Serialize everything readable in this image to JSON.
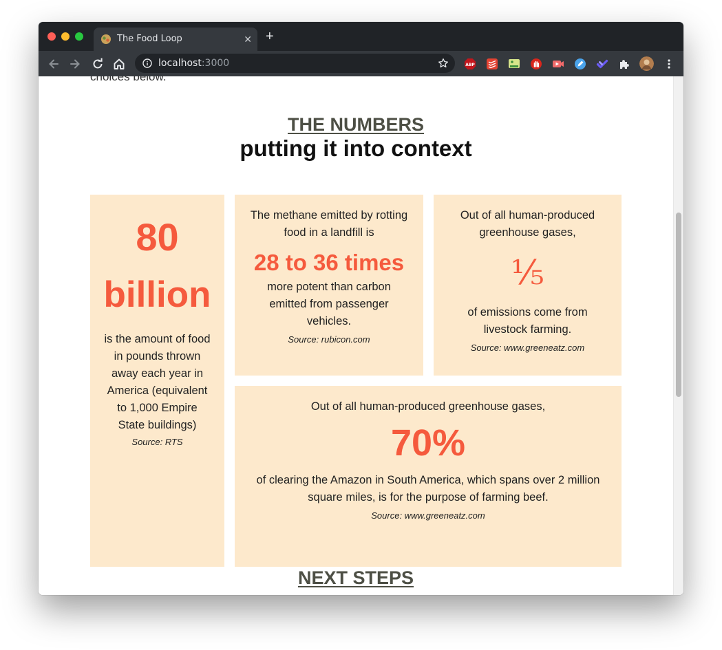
{
  "browser": {
    "tab_title": "The Food Loop",
    "new_tab": "+",
    "close": "✕",
    "url_host": "localhost",
    "url_port": ":3000",
    "extensions": [
      "adblock-icon",
      "todoist-icon",
      "screenshot-icon",
      "stop-icon",
      "video-icon",
      "pen-icon",
      "check-icon",
      "puzzle-icon",
      "profile-avatar",
      "menu-icon"
    ]
  },
  "page": {
    "partial_text": "choices below.",
    "numbers": {
      "eyebrow": "THE NUMBERS",
      "heading": "putting it into context"
    },
    "cards": [
      {
        "big_line1": "80",
        "big_line2": "billion",
        "text": "is the amount of food in pounds thrown away each year in America (equivalent to 1,000 Empire State buildings)",
        "source": "Source: RTS"
      },
      {
        "text_before": "The methane emitted by rotting food in a landfill is",
        "big": "28 to 36 times",
        "text_after": "more potent than carbon emitted from passenger vehicles.",
        "source": "Source: rubicon.com"
      },
      {
        "text_before": "Out of all human-produced greenhouse gases,",
        "big": "⅕",
        "text_after": "of emissions come from livestock farming.",
        "source": "Source: www.greeneatz.com"
      },
      {
        "text_before": "Out of all human-produced greenhouse gases,",
        "big": "70%",
        "text_after": "of clearing the Amazon in South America, which spans over 2 million square miles, is for the purpose of farming beef.",
        "source": "Source: www.greeneatz.com"
      }
    ],
    "next": {
      "eyebrow": "NEXT STEPS"
    }
  },
  "colors": {
    "card_bg": "#fde9cc",
    "accent": "#f55a3d",
    "eyebrow": "#4d4f45"
  }
}
